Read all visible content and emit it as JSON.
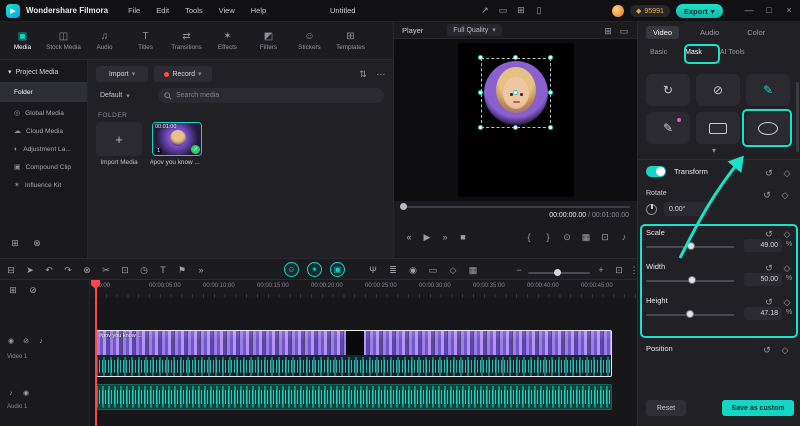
{
  "titlebar": {
    "app_name": "Wondershare Filmora",
    "menus": [
      "File",
      "Edit",
      "Tools",
      "View",
      "Help"
    ],
    "project_title": "Untitled",
    "coin_count": "95991",
    "coin_icon": "◆",
    "export_label": "Export",
    "export_caret": "▾",
    "logo_glyph": "▶",
    "icons": [
      {
        "name": "share-icon",
        "glyph": "↗"
      },
      {
        "name": "display-icon",
        "glyph": "▭"
      },
      {
        "name": "apps-icon",
        "glyph": "⊞"
      },
      {
        "name": "device-icon",
        "glyph": "▯"
      }
    ],
    "window_controls": [
      {
        "name": "minimize-icon",
        "glyph": "—"
      },
      {
        "name": "maximize-icon",
        "glyph": "□"
      },
      {
        "name": "close-icon",
        "glyph": "×"
      }
    ]
  },
  "media_tabs": [
    {
      "name": "tab-media",
      "label": "Media",
      "glyph": "▣",
      "active": true
    },
    {
      "name": "tab-stock-media",
      "label": "Stock Media",
      "glyph": "◫",
      "active": false
    },
    {
      "name": "tab-audio",
      "label": "Audio",
      "glyph": "♫",
      "active": false
    },
    {
      "name": "tab-titles",
      "label": "Titles",
      "glyph": "T",
      "active": false
    },
    {
      "name": "tab-transitions",
      "label": "Transitions",
      "glyph": "⇄",
      "active": false
    },
    {
      "name": "tab-effects",
      "label": "Effects",
      "glyph": "✶",
      "active": false
    },
    {
      "name": "tab-filters",
      "label": "Filters",
      "glyph": "◩",
      "active": false
    },
    {
      "name": "tab-stickers",
      "label": "Stickers",
      "glyph": "☺",
      "active": false
    },
    {
      "name": "tab-templates",
      "label": "Templates",
      "glyph": "⊞",
      "active": false
    }
  ],
  "sidebar": {
    "project_media_label": "Project Media",
    "chevron": "▾",
    "items": [
      {
        "name": "sidebar-item-folder",
        "label": "Folder",
        "glyph": "",
        "selected": true
      },
      {
        "name": "sidebar-item-global-media",
        "label": "Global Media",
        "glyph": "◎",
        "selected": false
      },
      {
        "name": "sidebar-item-cloud-media",
        "label": "Cloud Media",
        "glyph": "☁",
        "selected": false
      },
      {
        "name": "sidebar-item-adjustment-layer",
        "label": "Adjustment La...",
        "glyph": "◐",
        "selected": false
      },
      {
        "name": "sidebar-item-compound-clip",
        "label": "Compound Clip",
        "glyph": "▣",
        "selected": false
      },
      {
        "name": "sidebar-item-influence-kit",
        "label": "Influence Kit",
        "glyph": "✶",
        "selected": false
      }
    ],
    "bottom_icons": [
      {
        "name": "new-folder-icon",
        "glyph": "⊞"
      },
      {
        "name": "delete-folder-icon",
        "glyph": "⊗"
      }
    ]
  },
  "media_panel": {
    "import_label": "Import",
    "record_label": "Record",
    "default_label": "Default",
    "caret": "▾",
    "search_placeholder": "Search media",
    "folder_section_label": "FOLDER",
    "import_tile_glyph": "+",
    "import_tile_label": "Import Media",
    "clip_name": "#pov you know ...",
    "clip_duration": "00:01:00",
    "clip_order": "1",
    "clip_check": "✓",
    "filter_icon": "⇅",
    "more_icon": "⋯"
  },
  "player": {
    "title": "Player",
    "quality": "Full Quality",
    "quality_caret": "▾",
    "current_time": "00:00:00.00",
    "separator": " / ",
    "duration": "00:01:00.00",
    "header_icons": [
      {
        "name": "split-view-icon",
        "glyph": "⊞"
      },
      {
        "name": "preview-window-icon",
        "glyph": "▭"
      }
    ],
    "transport": [
      {
        "name": "previous-frame-icon",
        "glyph": "«"
      },
      {
        "name": "play-icon",
        "glyph": "▶"
      },
      {
        "name": "next-frame-icon",
        "glyph": "»"
      },
      {
        "name": "stop-icon",
        "glyph": "■"
      }
    ],
    "tools": [
      {
        "name": "mark-in-icon",
        "glyph": "{"
      },
      {
        "name": "mark-out-icon",
        "glyph": "}"
      },
      {
        "name": "snapshot-icon",
        "glyph": "⊙"
      },
      {
        "name": "compare-icon",
        "glyph": "▦"
      },
      {
        "name": "fullscreen-icon",
        "glyph": "⊡"
      },
      {
        "name": "volume-icon",
        "glyph": "♪"
      }
    ]
  },
  "properties": {
    "tabs": [
      {
        "name": "tab-video",
        "label": "Video",
        "active": true
      },
      {
        "name": "tab-audio-props",
        "label": "Audio",
        "active": false
      },
      {
        "name": "tab-color",
        "label": "Color",
        "active": false
      }
    ],
    "subtabs": [
      {
        "name": "subtab-basic",
        "label": "Basic",
        "active": false
      },
      {
        "name": "subtab-mask",
        "label": "Mask",
        "active": true
      },
      {
        "name": "subtab-ai-tools",
        "label": "AI Tools",
        "active": false
      }
    ],
    "mask_shapes": [
      {
        "name": "mask-flip-icon",
        "type": "glyph",
        "glyph": "↻",
        "accent": false,
        "badge": false
      },
      {
        "name": "mask-none-icon",
        "type": "glyph",
        "glyph": "⊘",
        "accent": false,
        "badge": false
      },
      {
        "name": "mask-draw-icon",
        "type": "glyph",
        "glyph": "✎",
        "accent": true,
        "badge": false
      },
      {
        "name": "mask-pen-icon",
        "type": "glyph",
        "glyph": "✎",
        "accent": false,
        "badge": true
      },
      {
        "name": "mask-rectangle-icon",
        "type": "rect",
        "glyph": "",
        "accent": false,
        "badge": false
      },
      {
        "name": "mask-ellipse-icon",
        "type": "ellipse",
        "glyph": "",
        "accent": false,
        "badge": false
      }
    ],
    "mask_expand_glyph": "▾",
    "transform_label": "Transform",
    "rotate_label": "Rotate",
    "rotate_value": "0.00°",
    "sliders": [
      {
        "label": "Scale",
        "value": "49.00",
        "unit": "%",
        "pct": 49
      },
      {
        "label": "Width",
        "value": "50.00",
        "unit": "%",
        "pct": 50
      },
      {
        "label": "Height",
        "value": "47.18",
        "unit": "%",
        "pct": 47.18
      }
    ],
    "position_label": "Position",
    "reset_icon": "↺",
    "keyframe_icon": "◇",
    "reset_label": "Reset",
    "save_label": "Save as custom"
  },
  "timeline": {
    "toolbar_left": [
      {
        "name": "timeline-panel-icon",
        "glyph": "⊟"
      },
      {
        "name": "pointer-tool-icon",
        "glyph": "➤"
      },
      {
        "name": "undo-icon",
        "glyph": "↶"
      },
      {
        "name": "redo-icon",
        "glyph": "↷"
      },
      {
        "name": "delete-icon",
        "glyph": "⊗"
      },
      {
        "name": "split-icon",
        "glyph": "✂"
      },
      {
        "name": "crop-icon",
        "glyph": "⊡"
      },
      {
        "name": "speed-icon",
        "glyph": "◷"
      },
      {
        "name": "text-tool-icon",
        "glyph": "T"
      },
      {
        "name": "marker-icon",
        "glyph": "⚑"
      },
      {
        "name": "more-tools-icon",
        "glyph": "»"
      }
    ],
    "quick_circles": [
      {
        "name": "emoji-tool-icon",
        "glyph": "☺"
      },
      {
        "name": "effects-quick-icon",
        "glyph": "✶"
      },
      {
        "name": "overlay-quick-icon",
        "glyph": "▣"
      }
    ],
    "toolbar_mid": [
      {
        "name": "voiceover-icon",
        "glyph": "Ψ"
      },
      {
        "name": "audio-mixer-icon",
        "glyph": "≣"
      },
      {
        "name": "record-icon",
        "glyph": "◉"
      },
      {
        "name": "screen-record-icon",
        "glyph": "▭"
      },
      {
        "name": "keyframe-toolbar-icon",
        "glyph": "◇"
      },
      {
        "name": "render-preview-icon",
        "glyph": "▦"
      }
    ],
    "zoom_out_glyph": "−",
    "zoom_in_glyph": "+",
    "fit_glyph": "⊡",
    "more_glyph": "⋮",
    "header_icons": [
      {
        "name": "manage-tracks-icon",
        "glyph": "⊞"
      },
      {
        "name": "track-lock-icon",
        "glyph": "⊘"
      }
    ],
    "ruler": [
      "00:00",
      "00:00:05:00",
      "00:00:10:00",
      "00:00:15:00",
      "00:00:20:00",
      "00:00:25:00",
      "00:00:30:00",
      "00:00:35:00",
      "00:00:40:00",
      "00:00:45:00"
    ],
    "video_track": {
      "label": "Video 1",
      "icons": [
        {
          "name": "track-visibility-icon",
          "glyph": "◉"
        },
        {
          "name": "track-lock-icon",
          "glyph": "⊘"
        },
        {
          "name": "track-mute-icon",
          "glyph": "♪"
        }
      ]
    },
    "audio_track": {
      "label": "Audio 1",
      "icons": [
        {
          "name": "track-mute-icon",
          "glyph": "♪"
        },
        {
          "name": "track-record-icon",
          "glyph": "◉"
        }
      ]
    }
  },
  "colors": {
    "accent": "#14d7c3",
    "annotation": "#17e3c9",
    "coin_orange": "#f0a63c",
    "playhead_red": "#ff4545",
    "check_green": "#2ecc71"
  }
}
